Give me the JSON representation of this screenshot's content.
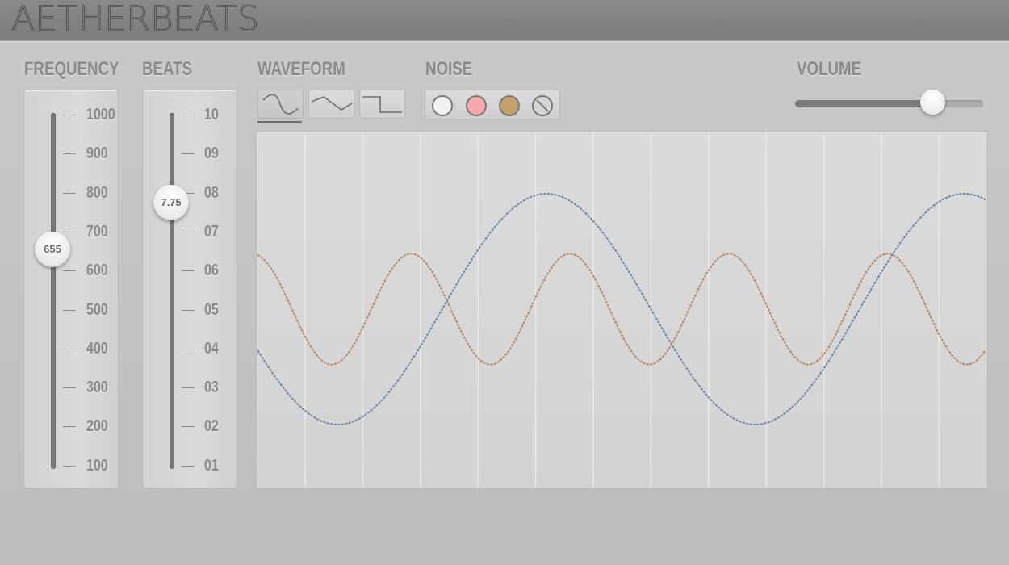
{
  "app": {
    "title": "AETHERBEATS"
  },
  "sections": {
    "frequency": "FREQUENCY",
    "beats": "BEATS",
    "waveform": "WAVEFORM",
    "noise": "NOISE",
    "volume": "VOLUME"
  },
  "frequency": {
    "ticks": [
      "1000",
      "900",
      "800",
      "700",
      "600",
      "500",
      "400",
      "300",
      "200",
      "100"
    ],
    "value": "655",
    "min": 100,
    "max": 1000,
    "current": 655
  },
  "beats": {
    "ticks": [
      "10",
      "09",
      "08",
      "07",
      "06",
      "05",
      "04",
      "03",
      "02",
      "01"
    ],
    "value": "7.75",
    "min": 1,
    "max": 10,
    "current": 7.75
  },
  "waveform": {
    "options": [
      {
        "name": "sine",
        "icon": "sine-wave-icon",
        "selected": true
      },
      {
        "name": "triangle",
        "icon": "triangle-wave-icon",
        "selected": false
      },
      {
        "name": "square",
        "icon": "square-wave-icon",
        "selected": false
      }
    ]
  },
  "noise": {
    "options": [
      {
        "name": "white",
        "icon": "white-noise-icon",
        "color": "#f2f2f2"
      },
      {
        "name": "pink",
        "icon": "pink-noise-icon",
        "color": "#f3a9ab"
      },
      {
        "name": "brown",
        "icon": "brown-noise-icon",
        "color": "#c4a06a"
      },
      {
        "name": "none",
        "icon": "no-noise-icon",
        "color": "#d6d6d6"
      }
    ]
  },
  "volume": {
    "level": 0.73
  },
  "colors": {
    "wave_blue": "#6c86a8",
    "wave_orange": "#b98867",
    "grid": "#e9e9e9"
  },
  "chart_data": {
    "type": "line",
    "series": [
      {
        "color": "#6c86a8",
        "cycles": 1.75,
        "phase_deg": 200,
        "amplitude": 1.0
      },
      {
        "color": "#b98867",
        "cycles": 4.6,
        "phase_deg": 100,
        "amplitude": 0.48
      }
    ],
    "grid": true,
    "vertical_gridlines": 12
  }
}
